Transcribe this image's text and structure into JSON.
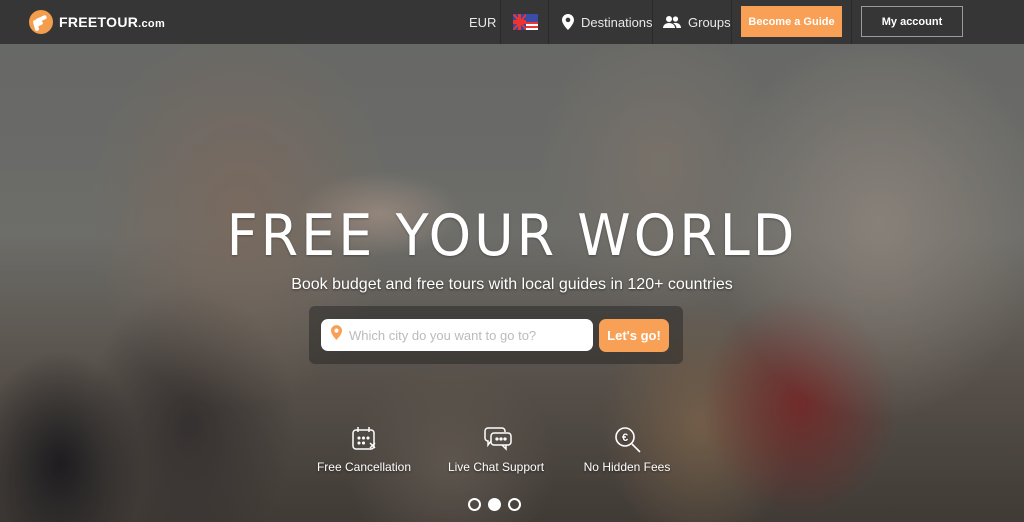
{
  "navbar": {
    "brand": {
      "name": "FREETOUR",
      "tld": ".com",
      "icon": "freetour-logo-icon"
    },
    "currency": "EUR",
    "language_flag": "uk-us-flag-icon",
    "destinations": {
      "label": "Destinations",
      "icon": "map-pin-icon"
    },
    "groups": {
      "label": "Groups",
      "icon": "users-icon"
    },
    "become_guide": "Become a Guide",
    "my_account": "My account"
  },
  "colors": {
    "accent": "#f8a055",
    "navbar_bg": "#363636",
    "logo": "#f49d4d"
  },
  "hero": {
    "title": "FREE YOUR WORLD",
    "subtitle": "Book budget and free tours with local guides in 120+ countries",
    "search": {
      "placeholder": "Which city do you want to go to?",
      "value": "",
      "icon": "map-pin-icon",
      "button": "Let's go!"
    },
    "features": [
      {
        "label": "Free Cancellation",
        "icon": "calendar-cancel-icon"
      },
      {
        "label": "Live Chat Support",
        "icon": "chat-bubbles-icon"
      },
      {
        "label": "No Hidden Fees",
        "icon": "euro-search-icon"
      }
    ],
    "carousel": {
      "total": 3,
      "active": 2
    }
  }
}
